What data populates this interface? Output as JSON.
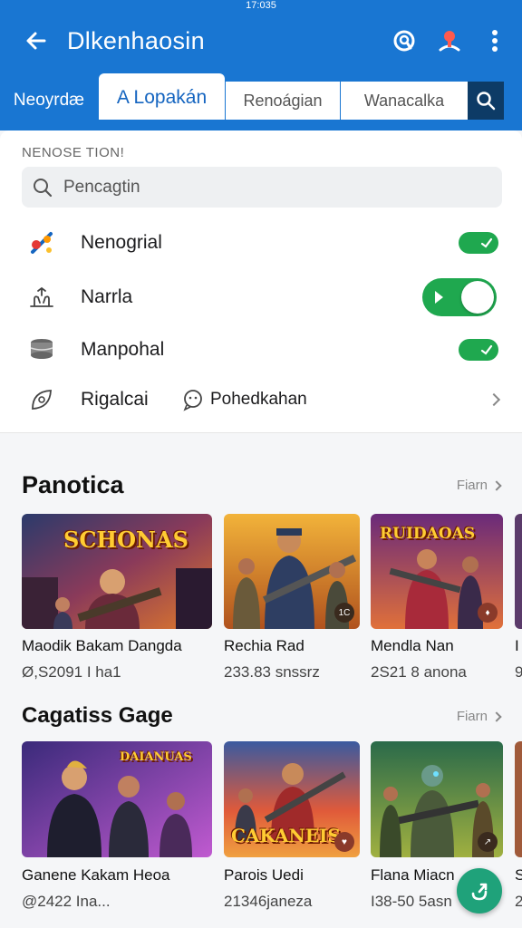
{
  "status": {
    "time": "17:035"
  },
  "appbar": {
    "title": "Dlkenhaosin"
  },
  "tabs": [
    {
      "label": "Neoyrdæ"
    },
    {
      "label": "A Lopakán"
    },
    {
      "label": "Renoágian"
    },
    {
      "label": "Wanacalka"
    }
  ],
  "settings": {
    "section_label": "NENOSE TION!",
    "search_placeholder": "Pencagtin",
    "rows": [
      {
        "label": "Nenogrial",
        "toggle_on": true
      },
      {
        "label": "Narrla",
        "toggle_on": true
      },
      {
        "label": "Manpohal",
        "toggle_on": true
      }
    ],
    "last_row": {
      "label": "Rigalcai",
      "secondary": "Pohedkahan"
    }
  },
  "sections": [
    {
      "title": "Panotica",
      "see_all": "Fiarn",
      "cards": [
        {
          "title": "Maodik Bakam Dangda",
          "sub": "Ø,S2091 I ha1",
          "art_text": "SCHONAS",
          "badge": ""
        },
        {
          "title": "Rechia Rad",
          "sub": "233.83 snssrz",
          "art_text": "",
          "badge": "1C"
        },
        {
          "title": "Mendla Nan",
          "sub": "2S21 8 anona",
          "art_text": "RUIDAOAS",
          "badge": "♦"
        },
        {
          "title": "I",
          "sub": "9",
          "art_text": "",
          "badge": ""
        }
      ]
    },
    {
      "title": "Cagatiss Gage",
      "see_all": "Fiarn",
      "cards": [
        {
          "title": "Ganene Kakam Heoa",
          "sub": "@2422 Ina...",
          "art_text": "DAIANUAS",
          "badge": ""
        },
        {
          "title": "Parois Uedi",
          "sub": "21346janeza",
          "art_text": "CAKANEIS",
          "badge": "♥"
        },
        {
          "title": "Flana Miacn",
          "sub": "I38-50 5asn",
          "art_text": "",
          "badge": "↗"
        },
        {
          "title": "S",
          "sub": "2",
          "art_text": "",
          "badge": ""
        }
      ]
    }
  ],
  "colors": {
    "primary": "#1976d2",
    "toggle": "#1fa84f",
    "fab": "#1fa27a",
    "tab_search": "#0d3b66"
  }
}
